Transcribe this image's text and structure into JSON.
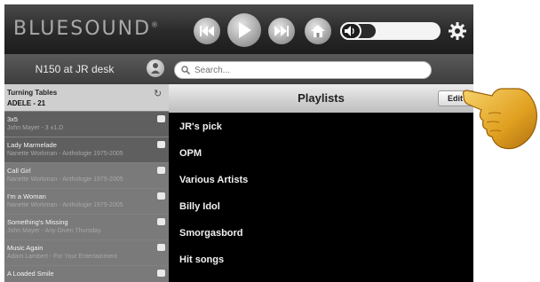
{
  "brand": {
    "logo_text": "BLUESOUND",
    "registered_mark": "®"
  },
  "toolbar": {
    "prev_icon": "skip-back-icon",
    "play_icon": "play-icon",
    "next_icon": "skip-forward-icon",
    "home_icon": "home-icon",
    "volume_icon": "speaker-icon",
    "volume_level": 0.35,
    "settings_icon": "gear-icon"
  },
  "player": {
    "name": "N150 at JR desk",
    "group_icon": "group-icon"
  },
  "search": {
    "placeholder": "Search..."
  },
  "queue": {
    "header": {
      "title": "Turning Tables",
      "subtitle": "ADELE - 21"
    },
    "items": [
      {
        "title": "3x5",
        "subtitle": "John Mayer - 3 ±1.D"
      },
      {
        "title": "Lady Marmelade",
        "subtitle": "Nanette Workman - Anthologie 1975-2005"
      },
      {
        "title": "Call Girl",
        "subtitle": "Nanette Workman - Anthologie 1975-2005"
      },
      {
        "title": "I'm a Woman",
        "subtitle": "Nanette Workman - Anthologie 1975-2005"
      },
      {
        "title": "Something's Missing",
        "subtitle": "John Mayer - Any Given Thursday"
      },
      {
        "title": "Music Again",
        "subtitle": "Adam Lambert - For Your Entertainment"
      },
      {
        "title": "A Loaded Smile",
        "subtitle": ""
      }
    ]
  },
  "playlists": {
    "title": "Playlists",
    "edit_label": "Edit",
    "items": [
      "JR's pick",
      "OPM",
      "Various Artists",
      "Billy Idol",
      "Smorgasbord",
      "Hit songs"
    ]
  },
  "colors": {
    "background": "#000000",
    "toolbar": "#2a2a2a",
    "queue": "#6a6a6a",
    "hand": "#e0a020"
  }
}
